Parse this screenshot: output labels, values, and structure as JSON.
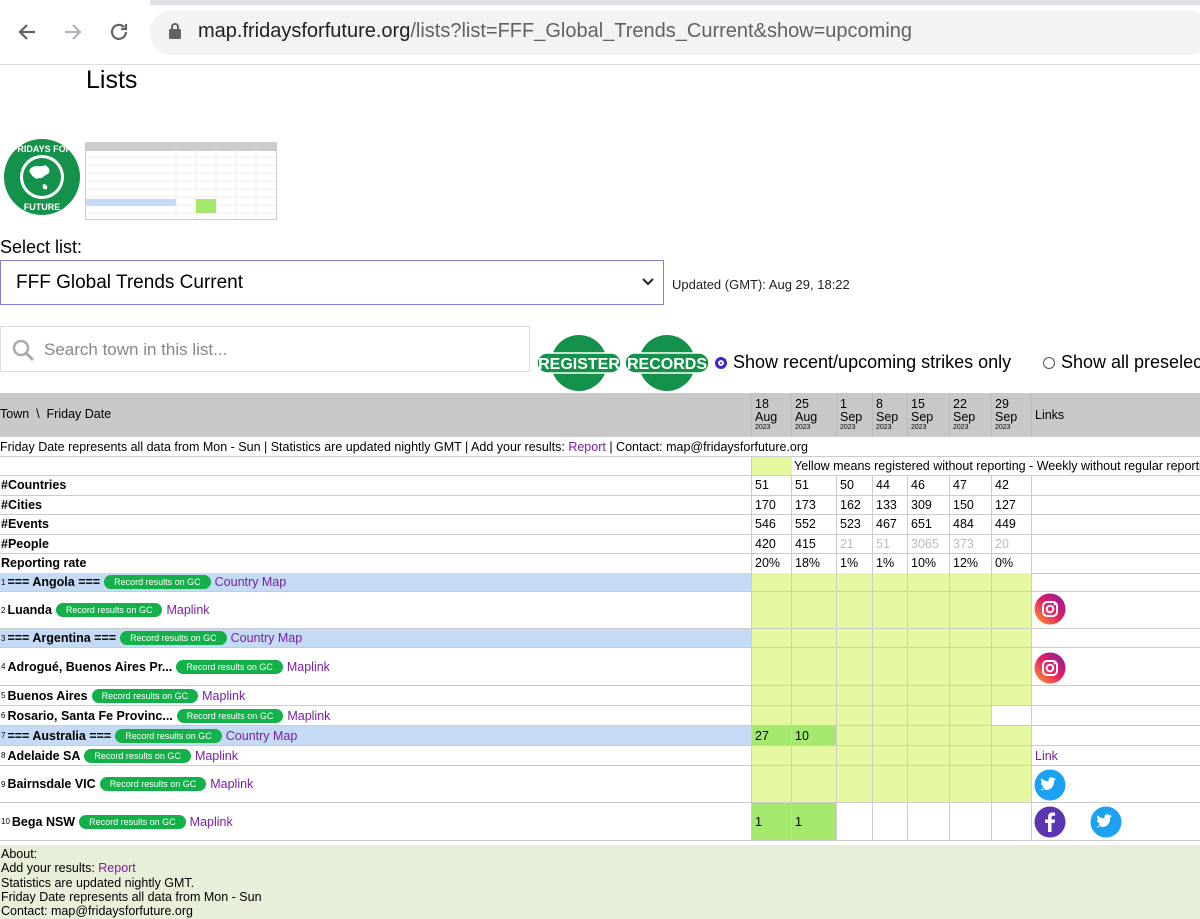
{
  "browser": {
    "url_host": "map.fridaysforfuture.org",
    "url_path": "/lists?list=FFF_Global_Trends_Current&show=upcoming"
  },
  "page": {
    "title": "Lists",
    "select_label": "Select list:",
    "selected_list": "FFF Global Trends Current",
    "updated": "Updated (GMT): Aug 29, 18:22",
    "search_placeholder": "Search town in this list...",
    "badge_register": "REGISTER",
    "badge_records": "RECORDS",
    "option_recent": "Show recent/upcoming strikes only",
    "option_all": "Show all preselected",
    "option_recent_selected": true
  },
  "table": {
    "header_town": "Town  \\  Friday Date",
    "header_links": "Links",
    "dates": [
      {
        "day": "18",
        "month": "Aug",
        "year": "2023"
      },
      {
        "day": "25",
        "month": "Aug",
        "year": "2023"
      },
      {
        "day": "1",
        "month": "Sep",
        "year": "2023"
      },
      {
        "day": "8",
        "month": "Sep",
        "year": "2023"
      },
      {
        "day": "15",
        "month": "Sep",
        "year": "2023"
      },
      {
        "day": "22",
        "month": "Sep",
        "year": "2023"
      },
      {
        "day": "29",
        "month": "Sep",
        "year": "2023"
      }
    ],
    "info_line_prefix": "Friday Date represents all data from Mon - Sun | Statistics are updated nightly GMT | Add your results: ",
    "info_line_link": "Report",
    "info_line_suffix": " | Contact: map@fridaysforfuture.org",
    "legend_yellow": "Yellow means registered without reporting - Weekly without regular reporting",
    "stats": [
      {
        "label": "#Countries",
        "values": [
          "51",
          "51",
          "50",
          "44",
          "46",
          "47",
          "42"
        ]
      },
      {
        "label": "#Cities",
        "values": [
          "170",
          "173",
          "162",
          "133",
          "309",
          "150",
          "127"
        ]
      },
      {
        "label": "#Events",
        "values": [
          "546",
          "552",
          "523",
          "467",
          "651",
          "484",
          "449"
        ]
      },
      {
        "label": "#People",
        "values": [
          "420",
          "415",
          "21",
          "51",
          "3065",
          "373",
          "20"
        ]
      },
      {
        "label": "Reporting rate",
        "values": [
          "20%",
          "18%",
          "1%",
          "1%",
          "10%",
          "12%",
          "0%"
        ]
      }
    ],
    "pill_label": "Record results on GC",
    "rows": [
      {
        "num": "1",
        "name": "=== Angola ===",
        "link": "Country Map"
      },
      {
        "num": "2",
        "name": "Luanda",
        "link": "Maplink"
      },
      {
        "num": "3",
        "name": "=== Argentina ===",
        "link": "Country Map"
      },
      {
        "num": "4",
        "name": "Adrogué, Buenos Aires Pr...",
        "link": "Maplink"
      },
      {
        "num": "5",
        "name": "Buenos Aires",
        "link": "Maplink"
      },
      {
        "num": "6",
        "name": "Rosario, Santa Fe Provinc...",
        "link": "Maplink"
      },
      {
        "num": "7",
        "name": "=== Australia ===",
        "link": "Country Map",
        "values": [
          "27",
          "10"
        ]
      },
      {
        "num": "8",
        "name": "Adelaide SA",
        "link": "Maplink",
        "links_text": "Link"
      },
      {
        "num": "9",
        "name": "Bairnsdale VIC",
        "link": "Maplink"
      },
      {
        "num": "10",
        "name": "Bega NSW",
        "link": "Maplink",
        "values": [
          "1",
          "1"
        ]
      }
    ],
    "icons": [
      "instagram-icon",
      "twitter-icon",
      "facebook-icon"
    ]
  },
  "about": {
    "title": "About:",
    "add_prefix": "Add your results: ",
    "add_link": "Report",
    "line_stats": "Statistics are updated nightly GMT.",
    "line_friday": "Friday Date represents all data from Mon - Sun",
    "line_contact": "Contact: map@fridaysforfuture.org"
  },
  "colors": {
    "registered_yellow": "#e4f8a0",
    "reported_green": "#a4e86e",
    "country_row_blue": "#c4daf5",
    "fff_green": "#14b14a",
    "link_purple": "#7b1fa2"
  }
}
